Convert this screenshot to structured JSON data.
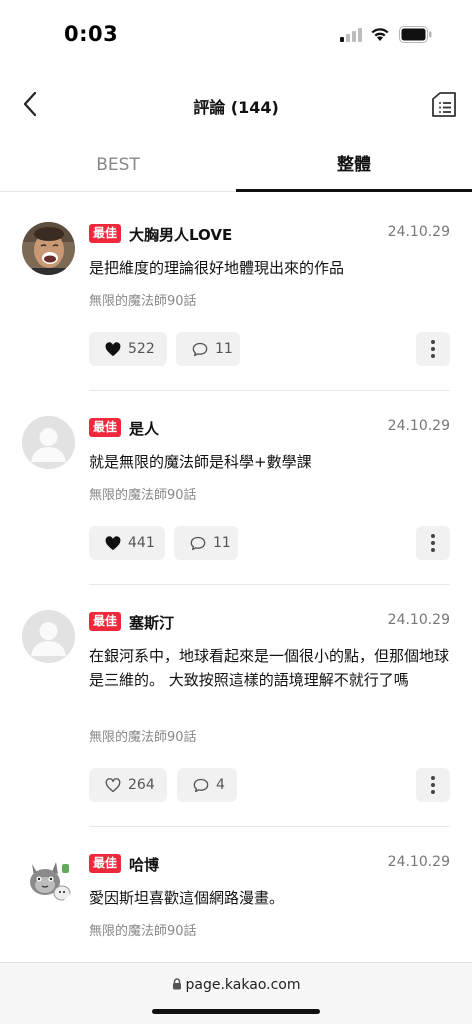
{
  "status_bar": {
    "time": "0:03"
  },
  "header": {
    "title": "評論 (144)"
  },
  "tabs": [
    {
      "label": "BEST",
      "active": false
    },
    {
      "label": "整體",
      "active": true
    }
  ],
  "comments": [
    {
      "badge": "最佳",
      "author": "大胸男人LOVE",
      "date": "24.10.29",
      "text": "是把維度的理論很好地體現出來的作品",
      "episode": "無限的魔法師90話",
      "likes": "522",
      "liked": true,
      "replies": "11",
      "avatar": "photo"
    },
    {
      "badge": "最佳",
      "author": "是人",
      "date": "24.10.29",
      "text": "就是無限的魔法師是科學+數學課",
      "episode": "無限的魔法師90話",
      "likes": "441",
      "liked": true,
      "replies": "11",
      "avatar": "default"
    },
    {
      "badge": "最佳",
      "author": "塞斯汀",
      "date": "24.10.29",
      "text": "在銀河系中，地球看起來是一個很小的點，但那個地球是三維的。 大致按照這樣的語境理解不就行了嗎",
      "episode": "無限的魔法師90話",
      "likes": "264",
      "liked": false,
      "replies": "4",
      "avatar": "default"
    },
    {
      "badge": "最佳",
      "author": "哈博",
      "date": "24.10.29",
      "text": "愛因斯坦喜歡這個網路漫畫。",
      "episode": "無限的魔法師90話",
      "avatar": "cartoon-cat"
    }
  ],
  "browser": {
    "url": "page.kakao.com"
  },
  "colors": {
    "badge": "#f0283c",
    "button_bg": "#f1f1f1",
    "accent_text": "#111111"
  }
}
